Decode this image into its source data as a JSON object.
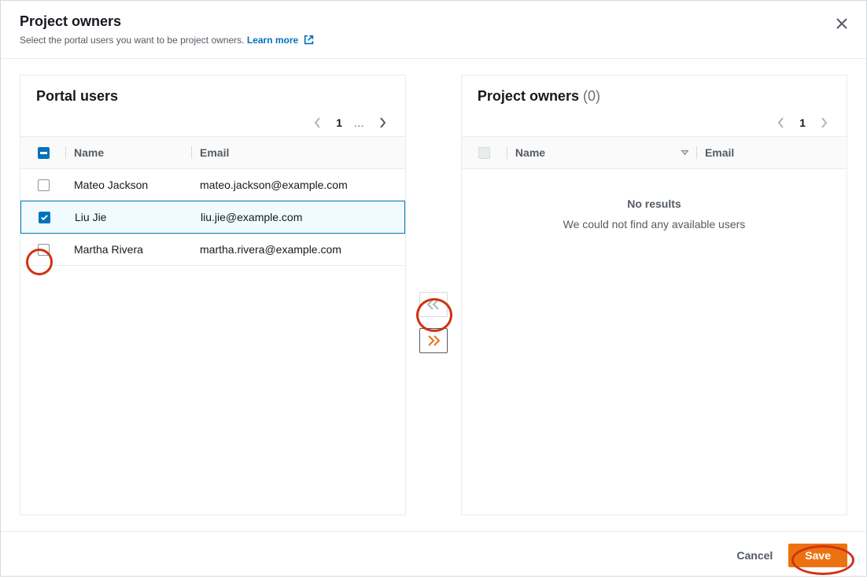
{
  "header": {
    "title": "Project owners",
    "subtitle": "Select the portal users you want to be project owners.",
    "learn_more": "Learn more"
  },
  "left_panel": {
    "title": "Portal users",
    "pagination": {
      "current": "1",
      "ellipsis": "…"
    },
    "columns": {
      "name": "Name",
      "email": "Email"
    },
    "rows": [
      {
        "name": "Mateo Jackson",
        "email": "mateo.jackson@example.com",
        "checked": false
      },
      {
        "name": "Liu Jie",
        "email": "liu.jie@example.com",
        "checked": true
      },
      {
        "name": "Martha Rivera",
        "email": "martha.rivera@example.com",
        "checked": false
      }
    ]
  },
  "right_panel": {
    "title": "Project owners",
    "count": "(0)",
    "pagination": {
      "current": "1"
    },
    "columns": {
      "name": "Name",
      "email": "Email"
    },
    "empty": {
      "title": "No results",
      "subtitle": "We could not find any available users"
    }
  },
  "footer": {
    "cancel": "Cancel",
    "save": "Save"
  }
}
